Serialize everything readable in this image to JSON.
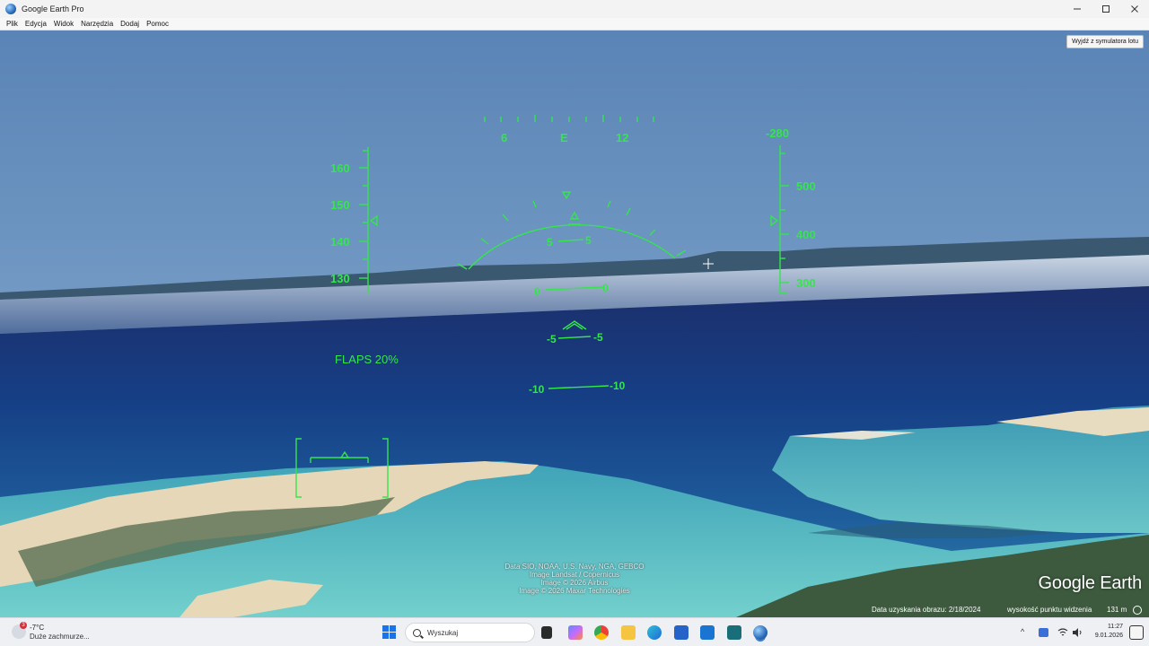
{
  "window": {
    "title": "Google Earth Pro",
    "minimize_icon": "minimize-icon",
    "maximize_icon": "maximize-icon",
    "close_icon": "close-icon"
  },
  "menu": [
    "Plik",
    "Edycja",
    "Widok",
    "Narzędzia",
    "Dodaj",
    "Pomoc"
  ],
  "simulator": {
    "exit_button": "Wyjdź z symulatora lotu",
    "flaps": "FLAPS 20%",
    "heading_labels": [
      "6",
      "E",
      "12"
    ],
    "speed_labels": [
      "160",
      "150",
      "140",
      "130"
    ],
    "altitude_top": "-280",
    "altitude_labels": [
      "500",
      "400",
      "300"
    ],
    "pitch_labels": {
      "p5_left": "5",
      "p5_right": "5",
      "p0_left": "0",
      "p0_right": "0",
      "m5_left": "-5",
      "m5_right": "-5",
      "m10_left": "-10",
      "m10_right": "-10"
    }
  },
  "credits": [
    "Data SIO, NOAA, U.S. Navy, NGA, GEBCO",
    "Image Landsat / Copernicus",
    "Image © 2026 Airbus",
    "Image © 2026 Maxar Technologies"
  ],
  "logo": "Google Earth",
  "status": {
    "imagery_date": "Data uzyskania obrazu: 2/18/2024",
    "eye_altitude_label": "wysokość punktu widzenia",
    "eye_altitude_value": "131 m"
  },
  "taskbar": {
    "weather_badge": "3",
    "temperature": "-7°C",
    "weather_desc": "Duże zachmurze...",
    "search_placeholder": "Wyszukaj",
    "time": "11:27",
    "date": "9.01.2026",
    "tray_chevron": "^"
  }
}
